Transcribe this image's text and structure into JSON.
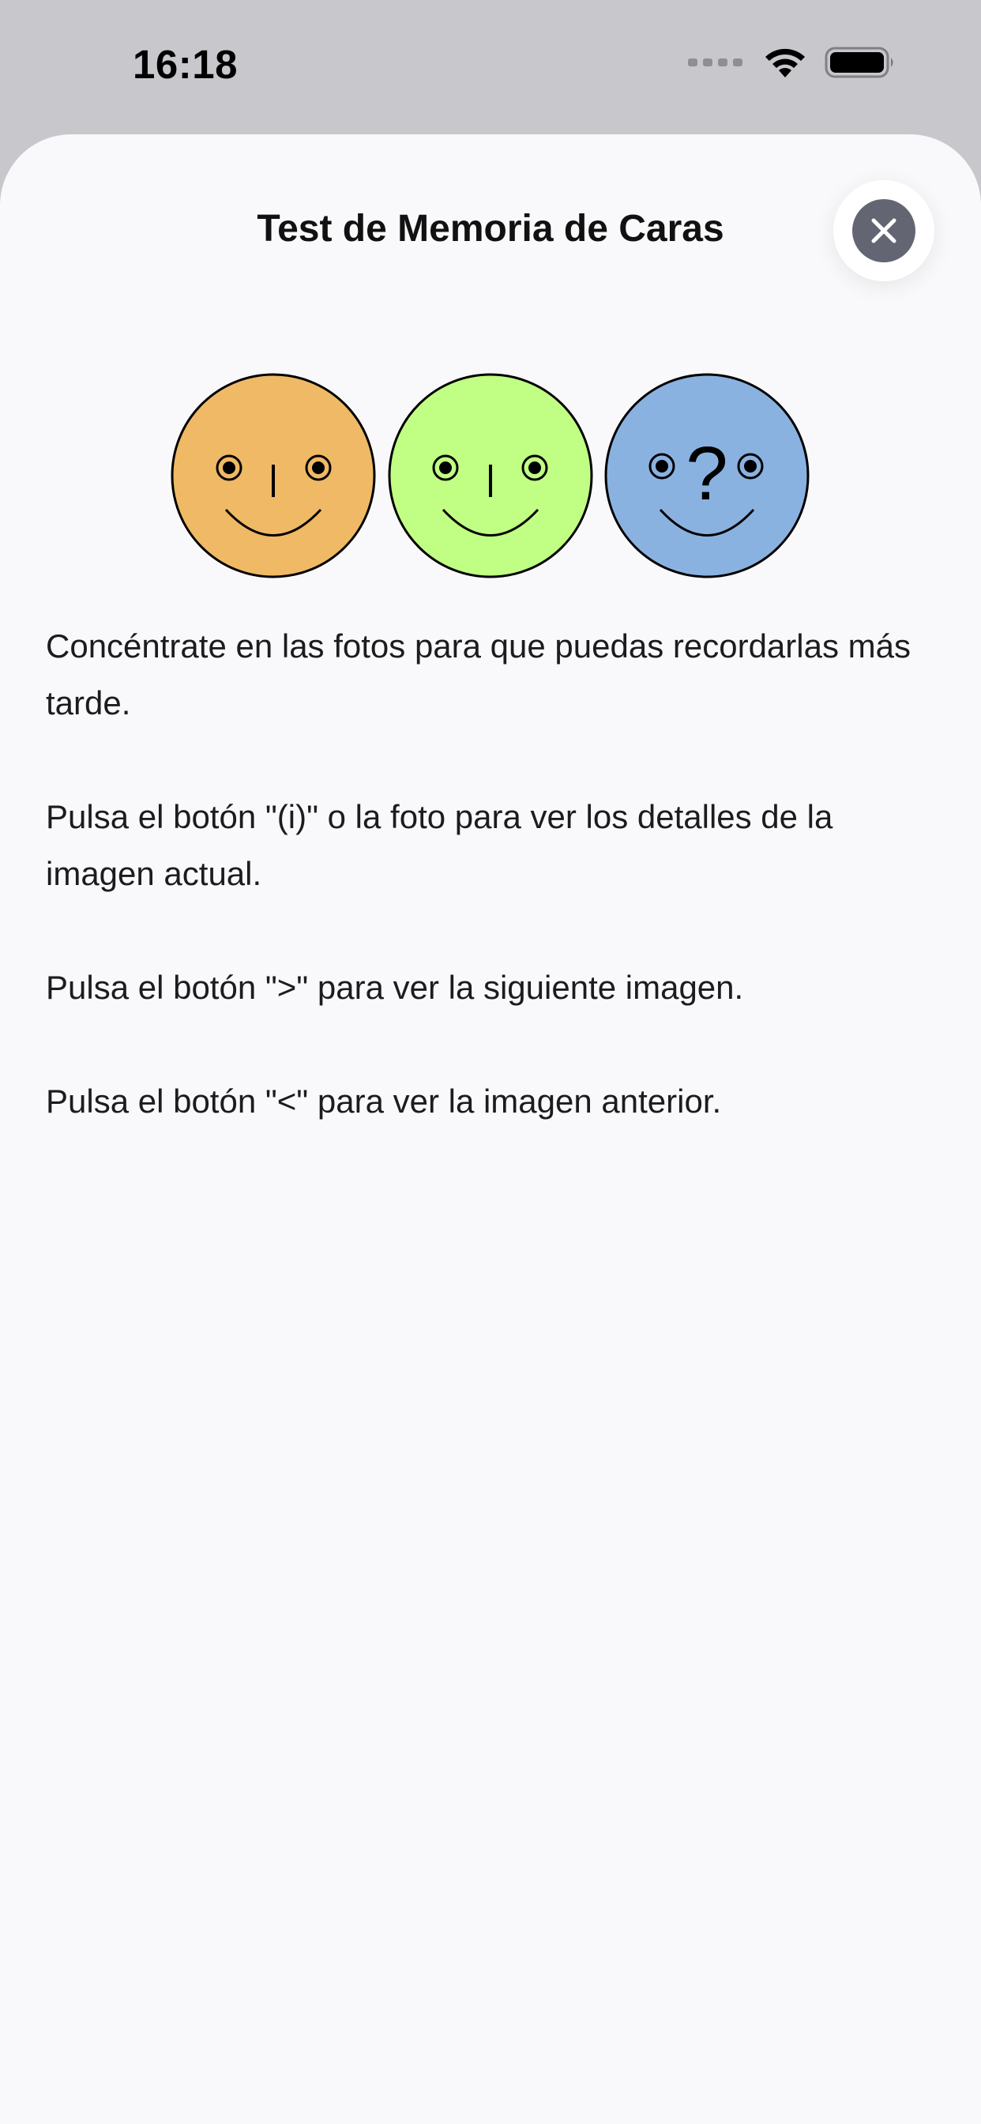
{
  "status_bar": {
    "time": "16:18",
    "signal_icon": "cellular-signal-icon",
    "wifi_icon": "wifi-icon",
    "battery_icon": "battery-icon"
  },
  "sheet": {
    "title": "Test de Memoria de Caras",
    "close_icon": "close-icon"
  },
  "faces": [
    {
      "name": "orange-smiley-face",
      "color": "#efb966"
    },
    {
      "name": "green-smiley-face",
      "color": "#c0fe84"
    },
    {
      "name": "blue-question-face",
      "color": "#8ab2e0",
      "mark": "?"
    }
  ],
  "instructions": [
    "Concéntrate en las fotos para que puedas recordarlas más tarde.",
    "Pulsa el botón \"(i)\" o la foto para ver los detalles de la imagen actual.",
    "Pulsa el botón \">\" para ver la siguiente imagen.",
    "Pulsa el botón \"<\" para ver la imagen anterior."
  ]
}
